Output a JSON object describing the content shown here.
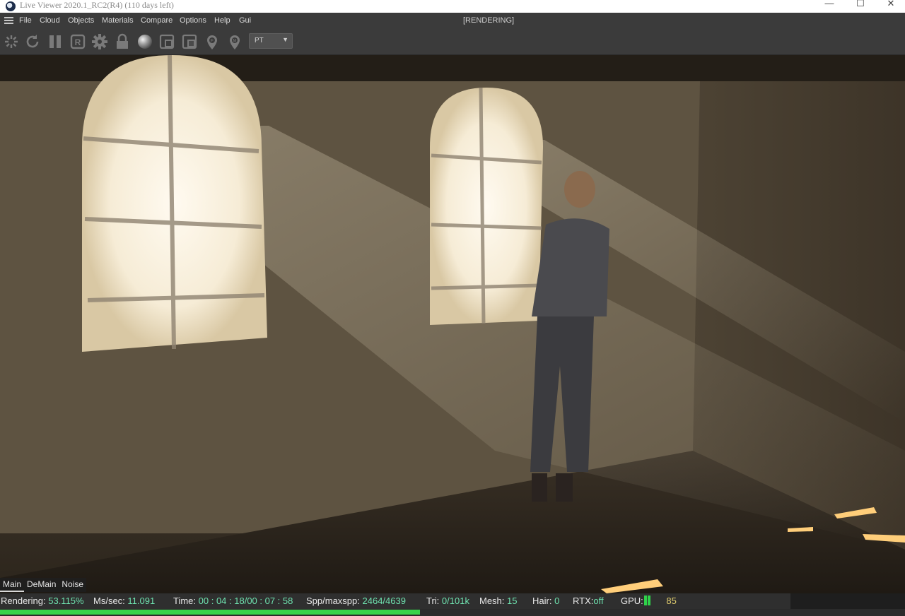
{
  "window": {
    "title": "Live Viewer 2020.1_RC2(R4) (110 days left)",
    "controls": {
      "minimize": "—",
      "maximize": "☐",
      "close": "✕"
    }
  },
  "menu": {
    "items": [
      "File",
      "Cloud",
      "Objects",
      "Materials",
      "Compare",
      "Options",
      "Help",
      "Gui"
    ],
    "status": "[RENDERING]"
  },
  "toolbar": {
    "buttons": [
      "camera-pick-icon",
      "restart-icon",
      "pause-icon",
      "region-r-icon",
      "settings-gear-icon",
      "lock-icon",
      "material-sphere-icon",
      "region-select-icon",
      "region-clear-icon",
      "focus-pin-f-icon",
      "focus-pin-m-icon"
    ],
    "kernel_mode": "PT"
  },
  "bottom_tabs": [
    "Main",
    "DeMain",
    "Noise"
  ],
  "bottom_tabs_active": 0,
  "status": {
    "rendering_label": "Rendering:",
    "rendering_value": "53.115%",
    "ms_label": "Ms/sec:",
    "ms_value": "11.091",
    "time_label": "Time:",
    "time_value": "00 : 04 : 18/00 : 07 : 58",
    "spp_label": "Spp/maxspp:",
    "spp_value": "2464/4639",
    "tri_label": "Tri:",
    "tri_value": "0/101k",
    "mesh_label": "Mesh:",
    "mesh_value": "15",
    "hair_label": "Hair:",
    "hair_value": "0",
    "rtx_label": "RTX:",
    "rtx_value": "off",
    "gpu_label": "GPU:",
    "gpu_value": "85"
  },
  "progress_fraction": 0.53115,
  "colors": {
    "accent_value": "#6fe3b0",
    "progress": "#37d34b",
    "gpu_temp": "#e3cf6f"
  }
}
